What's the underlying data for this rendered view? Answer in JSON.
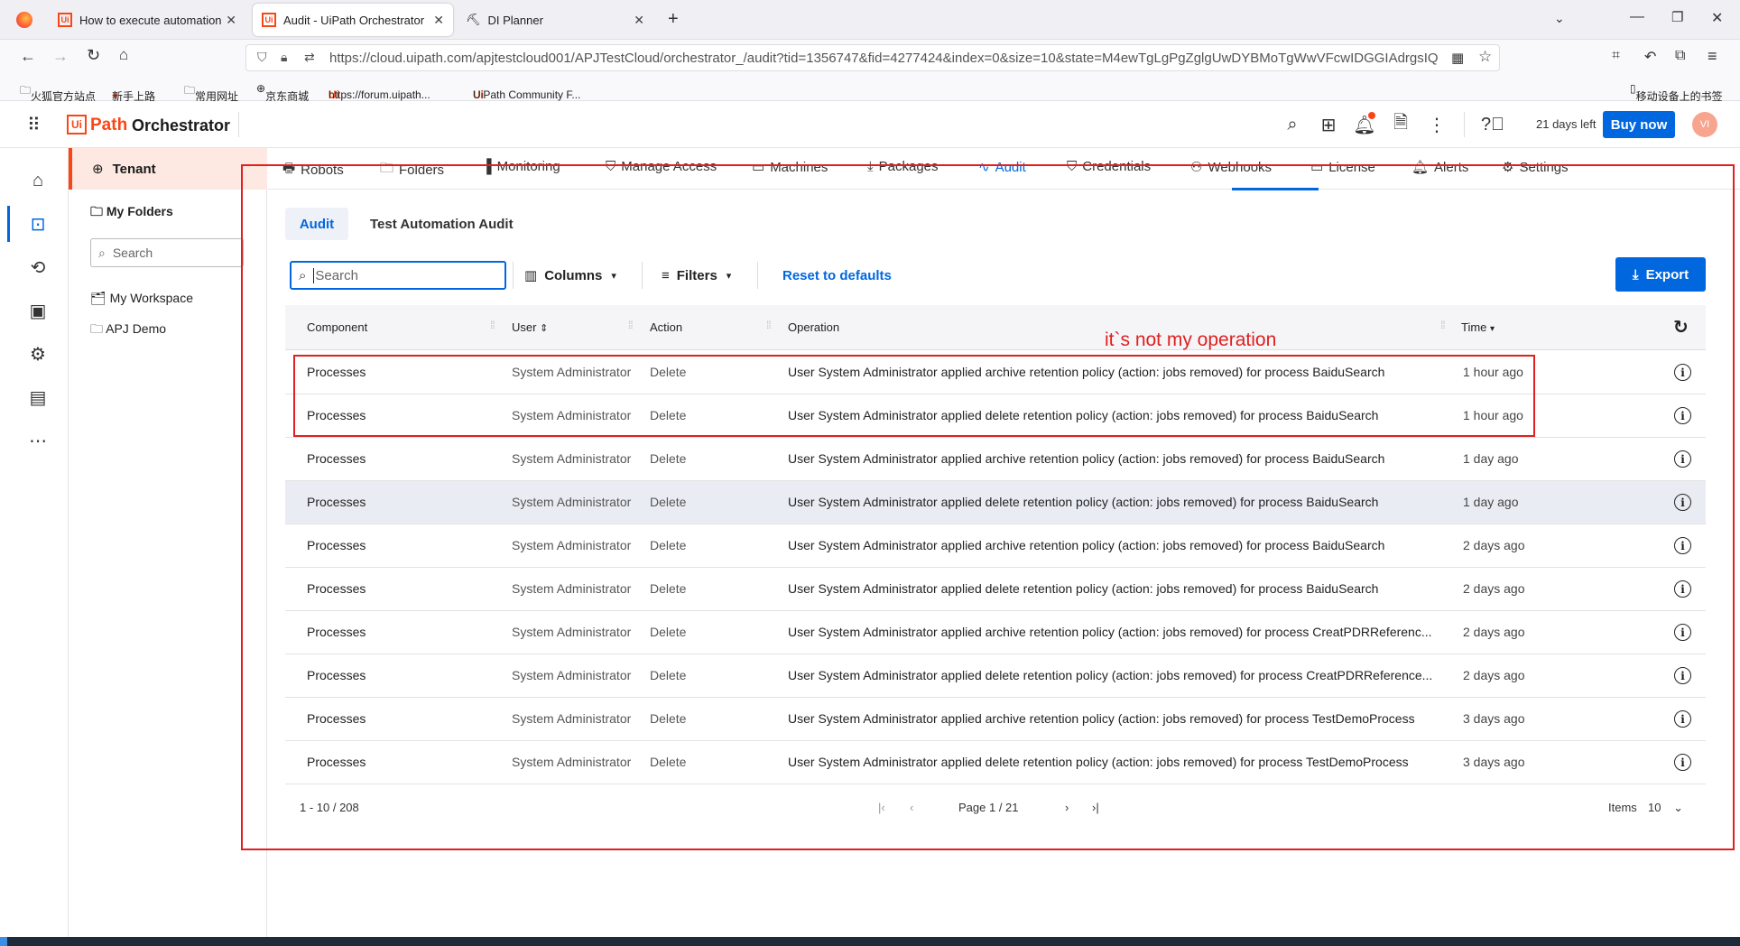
{
  "browser": {
    "tabs": [
      {
        "title": "How to execute automation"
      },
      {
        "title": "Audit - UiPath Orchestrator"
      },
      {
        "title": "DI Planner"
      }
    ],
    "url": "https://cloud.uipath.com/apjtestcloud001/APJTestCloud/orchestrator_/audit?tid=1356747&fid=4277424&index=0&size=10&state=M4ewTgLgPgZglgUwDYBMoTgWwVFcwIDGGIAdrgsIQ",
    "bookmarks": [
      "火狐官方站点",
      "新手上路",
      "常用网址",
      "京东商城",
      "https://forum.uipath...",
      "UiPath Community F..."
    ],
    "mobile_bookmarks": "移动设备上的书签"
  },
  "app": {
    "logo_ui": "Ui",
    "logo_path": "Path",
    "product": "Orchestrator",
    "trial": "21 days left",
    "buy": "Buy now",
    "avatar": "VI"
  },
  "tree": {
    "tenant": "Tenant",
    "my_folders": "My Folders",
    "search_placeholder": "Search",
    "items": [
      "My Workspace",
      "APJ Demo"
    ]
  },
  "nav": [
    "Robots",
    "Folders",
    "Monitoring",
    "Manage Access",
    "Machines",
    "Packages",
    "Audit",
    "Credentials",
    "Webhooks",
    "License",
    "Alerts",
    "Settings"
  ],
  "subtabs": [
    "Audit",
    "Test Automation Audit"
  ],
  "toolbar": {
    "search_placeholder": "Search",
    "columns": "Columns",
    "filters": "Filters",
    "reset": "Reset to defaults",
    "export": "Export"
  },
  "table": {
    "headers": {
      "component": "Component",
      "user": "User",
      "action": "Action",
      "operation": "Operation",
      "time": "Time"
    },
    "rows": [
      {
        "component": "Processes",
        "user": "System Administrator",
        "action": "Delete",
        "operation": "User System Administrator applied archive retention policy (action: jobs removed) for process BaiduSearch",
        "time": "1 hour ago"
      },
      {
        "component": "Processes",
        "user": "System Administrator",
        "action": "Delete",
        "operation": "User System Administrator applied delete retention policy (action: jobs removed) for process BaiduSearch",
        "time": "1 hour ago"
      },
      {
        "component": "Processes",
        "user": "System Administrator",
        "action": "Delete",
        "operation": "User System Administrator applied archive retention policy (action: jobs removed) for process BaiduSearch",
        "time": "1 day ago"
      },
      {
        "component": "Processes",
        "user": "System Administrator",
        "action": "Delete",
        "operation": "User System Administrator applied delete retention policy (action: jobs removed) for process BaiduSearch",
        "time": "1 day ago"
      },
      {
        "component": "Processes",
        "user": "System Administrator",
        "action": "Delete",
        "operation": "User System Administrator applied archive retention policy (action: jobs removed) for process BaiduSearch",
        "time": "2 days ago"
      },
      {
        "component": "Processes",
        "user": "System Administrator",
        "action": "Delete",
        "operation": "User System Administrator applied delete retention policy (action: jobs removed) for process BaiduSearch",
        "time": "2 days ago"
      },
      {
        "component": "Processes",
        "user": "System Administrator",
        "action": "Delete",
        "operation": "User System Administrator applied archive retention policy (action: jobs removed) for process CreatPDRReferenc...",
        "time": "2 days ago"
      },
      {
        "component": "Processes",
        "user": "System Administrator",
        "action": "Delete",
        "operation": "User System Administrator applied delete retention policy (action: jobs removed) for process CreatPDRReference...",
        "time": "2 days ago"
      },
      {
        "component": "Processes",
        "user": "System Administrator",
        "action": "Delete",
        "operation": "User System Administrator applied archive retention policy (action: jobs removed) for process TestDemoProcess",
        "time": "3 days ago"
      },
      {
        "component": "Processes",
        "user": "System Administrator",
        "action": "Delete",
        "operation": "User System Administrator applied delete retention policy (action: jobs removed) for process TestDemoProcess",
        "time": "3 days ago"
      }
    ]
  },
  "pagination": {
    "range": "1 - 10 / 208",
    "page": "Page 1 / 21",
    "items_label": "Items",
    "items_value": "10"
  },
  "annotation": "it`s not my operation"
}
